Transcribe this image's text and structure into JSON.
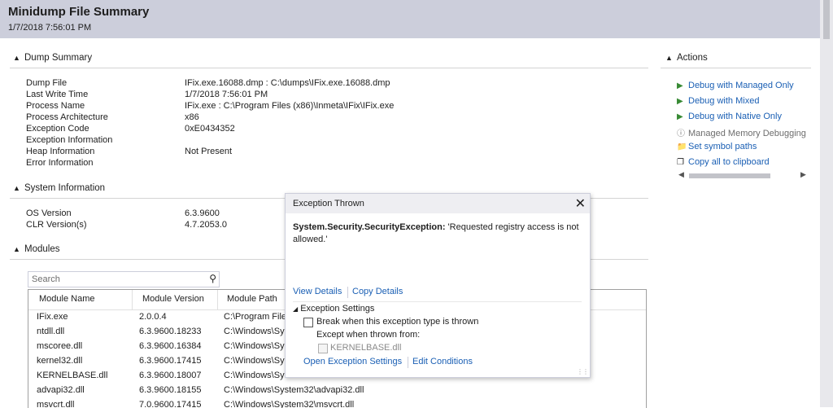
{
  "header": {
    "title": "Minidump File Summary",
    "date": "1/7/2018 7:56:01 PM"
  },
  "dump_summary": {
    "title": "Dump Summary",
    "rows": [
      {
        "label": "Dump File",
        "value": "IFix.exe.16088.dmp : C:\\dumps\\IFix.exe.16088.dmp"
      },
      {
        "label": "Last Write Time",
        "value": "1/7/2018 7:56:01 PM"
      },
      {
        "label": "Process Name",
        "value": "IFix.exe : C:\\Program Files (x86)\\Inmeta\\IFix\\IFix.exe"
      },
      {
        "label": "Process Architecture",
        "value": "x86"
      },
      {
        "label": "Exception Code",
        "value": "0xE0434352"
      },
      {
        "label": "Exception Information",
        "value": ""
      },
      {
        "label": "Heap Information",
        "value": "Not Present"
      },
      {
        "label": "Error Information",
        "value": ""
      }
    ]
  },
  "system_info": {
    "title": "System Information",
    "rows": [
      {
        "label": "OS Version",
        "value": "6.3.9600"
      },
      {
        "label": "CLR Version(s)",
        "value": "4.7.2053.0"
      }
    ]
  },
  "modules": {
    "title": "Modules",
    "search_placeholder": "Search",
    "columns": [
      "Module Name",
      "Module Version",
      "Module Path"
    ],
    "rows": [
      {
        "name": "IFix.exe",
        "version": "2.0.0.4",
        "path": "C:\\Program File"
      },
      {
        "name": "ntdll.dll",
        "version": "6.3.9600.18233",
        "path": "C:\\Windows\\Sy"
      },
      {
        "name": "mscoree.dll",
        "version": "6.3.9600.16384",
        "path": "C:\\Windows\\Sy"
      },
      {
        "name": "kernel32.dll",
        "version": "6.3.9600.17415",
        "path": "C:\\Windows\\Sy"
      },
      {
        "name": "KERNELBASE.dll",
        "version": "6.3.9600.18007",
        "path": "C:\\Windows\\Sy"
      },
      {
        "name": "advapi32.dll",
        "version": "6.3.9600.18155",
        "path": "C:\\Windows\\System32\\advapi32.dll"
      },
      {
        "name": "msvcrt.dll",
        "version": "7.0.9600.17415",
        "path": "C:\\Windows\\System32\\msvcrt.dll"
      }
    ]
  },
  "actions": {
    "title": "Actions",
    "items": [
      {
        "label": "Debug with Managed Only",
        "icon": "play-icon"
      },
      {
        "label": "Debug with Mixed",
        "icon": "play-icon"
      },
      {
        "label": "Debug with Native Only",
        "icon": "play-icon"
      },
      {
        "label": "Managed Memory Debugging",
        "icon": "info-icon"
      },
      {
        "label": "Set symbol paths",
        "icon": "folder-icon"
      },
      {
        "label": "Copy all to clipboard",
        "icon": "copy-icon"
      }
    ]
  },
  "exception_popup": {
    "title": "Exception Thrown",
    "exception_type": "System.Security.SecurityException:",
    "message": " 'Requested registry access is not allowed.'",
    "view_details": "View Details",
    "copy_details": "Copy Details",
    "settings_title": "Exception Settings",
    "break_label": "Break when this exception type is thrown",
    "except_label": "Except when thrown from:",
    "module_label": "KERNELBASE.dll",
    "open_settings": "Open Exception Settings",
    "edit_conditions": "Edit Conditions"
  },
  "colors": {
    "header_bg": "#cccedb",
    "link": "#1a5fb4",
    "play_icon": "#388a34"
  }
}
